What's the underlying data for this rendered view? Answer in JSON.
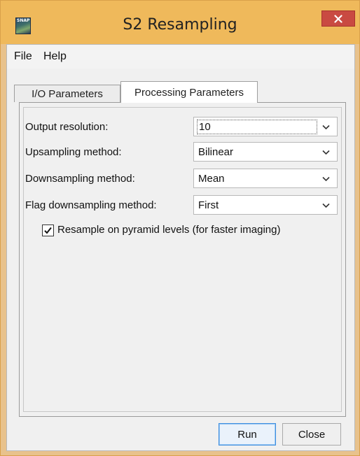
{
  "window": {
    "title": "S2 Resampling",
    "icon_text": "SNAP",
    "icon": "snap-app-icon",
    "close_icon": "close-icon",
    "accent_color": "#efb95b",
    "close_color": "#c94a42"
  },
  "menu": {
    "items": [
      {
        "label": "File"
      },
      {
        "label": "Help"
      }
    ]
  },
  "tabs": [
    {
      "label": "I/O Parameters",
      "active": false
    },
    {
      "label": "Processing Parameters",
      "active": true
    }
  ],
  "form": {
    "output_resolution": {
      "label": "Output resolution:",
      "value": "10"
    },
    "upsampling_method": {
      "label": "Upsampling method:",
      "value": "Bilinear"
    },
    "downsampling_method": {
      "label": "Downsampling method:",
      "value": "Mean"
    },
    "flag_downsampling_method": {
      "label": "Flag downsampling method:",
      "value": "First"
    },
    "pyramid_checkbox": {
      "label": "Resample on pyramid levels (for faster imaging)",
      "checked": true
    }
  },
  "buttons": {
    "run": "Run",
    "close": "Close"
  }
}
